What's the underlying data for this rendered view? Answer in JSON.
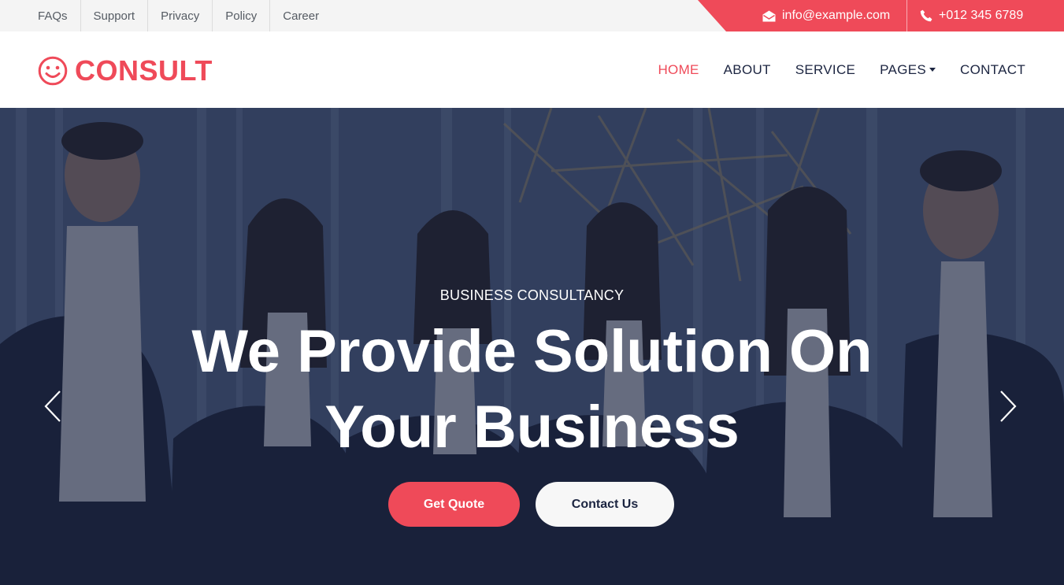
{
  "topbar": {
    "links": [
      "FAQs",
      "Support",
      "Privacy",
      "Policy",
      "Career"
    ],
    "email": "info@example.com",
    "phone": "+012 345 6789",
    "accent_color": "#ef4a59"
  },
  "navbar": {
    "brand": "CONSULT",
    "brand_icon": "smile-icon",
    "items": [
      {
        "label": "HOME",
        "active": true
      },
      {
        "label": "ABOUT",
        "active": false
      },
      {
        "label": "SERVICE",
        "active": false
      },
      {
        "label": "PAGES",
        "active": false,
        "dropdown": true
      },
      {
        "label": "CONTACT",
        "active": false
      }
    ]
  },
  "hero": {
    "subtitle": "BUSINESS CONSULTANCY",
    "title_line1": "We Provide Solution On",
    "title_line2": "Your Business",
    "primary_button": "Get Quote",
    "secondary_button": "Contact Us",
    "prev_icon": "chevron-left-icon",
    "next_icon": "chevron-right-icon"
  },
  "colors": {
    "primary": "#ef4a59",
    "dark": "#1c2541",
    "topbar_bg": "#f4f4f4"
  }
}
